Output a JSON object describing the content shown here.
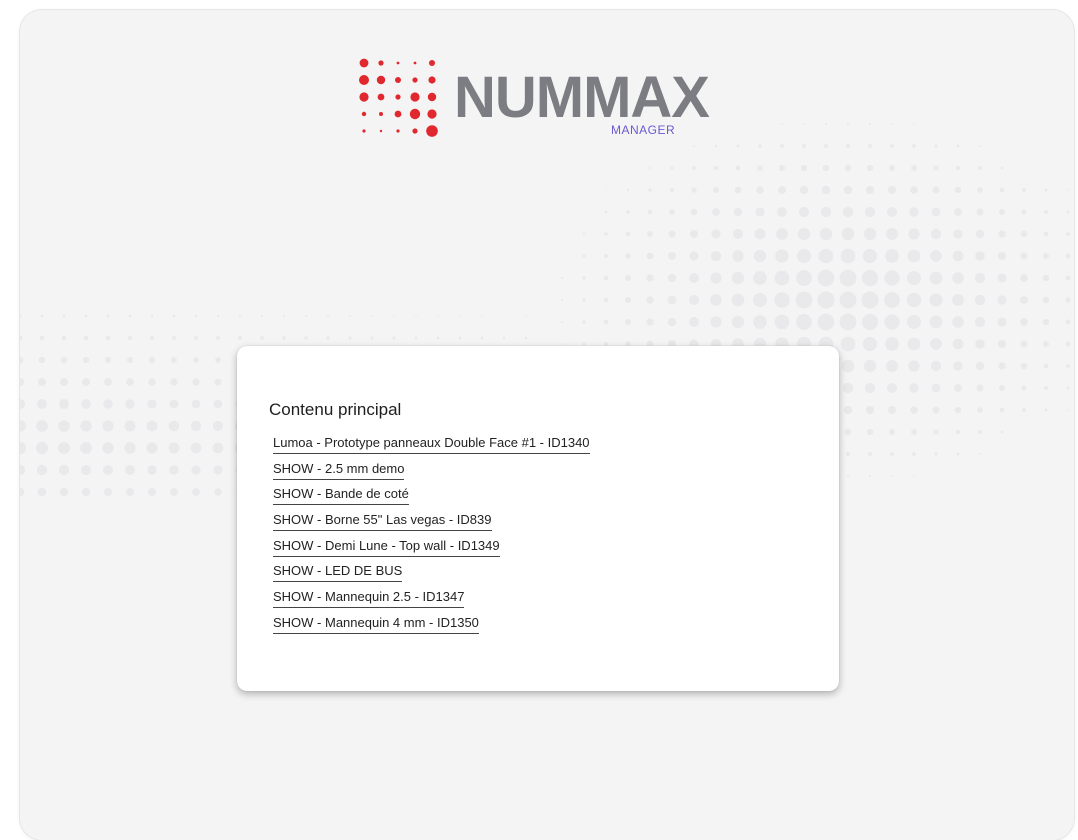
{
  "brand": {
    "name": "NUMMAX",
    "subtitle": "MANAGER",
    "accent_red": "#e0292f",
    "word_gray": "#7b7d82",
    "sub_purple": "#6a5ad0",
    "icon": "dot-matrix-logo"
  },
  "main": {
    "title": "Contenu principal",
    "items": [
      {
        "label": "Lumoa - Prototype panneaux Double Face #1 - ID1340"
      },
      {
        "label": "SHOW - 2.5 mm demo"
      },
      {
        "label": "SHOW - Bande de coté"
      },
      {
        "label": "SHOW - Borne 55\" Las vegas - ID839"
      },
      {
        "label": "SHOW - Demi Lune - Top wall - ID1349"
      },
      {
        "label": "SHOW - LED DE BUS"
      },
      {
        "label": "SHOW - Mannequin 2.5 - ID1347"
      },
      {
        "label": "SHOW - Mannequin 4 mm - ID1350"
      }
    ]
  },
  "colors": {
    "background": "#f4f4f5",
    "card": "#ffffff",
    "decor_dots": "#e9e9eb"
  }
}
